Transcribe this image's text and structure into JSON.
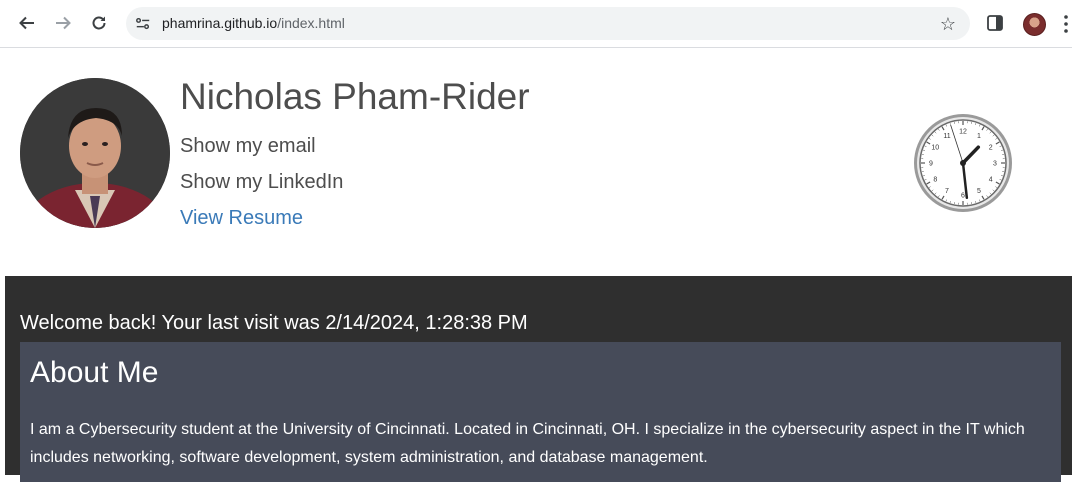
{
  "browser": {
    "url_host": "phamrina.github.io",
    "url_path": "/index.html"
  },
  "header": {
    "name": "Nicholas Pham-Rider",
    "email_link": "Show my email",
    "linkedin_link": "Show my LinkedIn",
    "resume_link": "View Resume"
  },
  "clock": {
    "numerals": [
      "12",
      "1",
      "2",
      "3",
      "4",
      "5",
      "6",
      "7",
      "8",
      "9",
      "10",
      "11"
    ],
    "time_shown": "1:28:57"
  },
  "welcome": {
    "message": "Welcome back! Your last visit was 2/14/2024, 1:28:38 PM"
  },
  "about": {
    "heading": "About Me",
    "text": "I am a Cybersecurity student at the University of Cincinnati. Located in Cincinnati, OH. I specialize in the cybersecurity aspect in the IT which includes networking, software development, system administration, and database management."
  },
  "colors": {
    "dark_background": "#2f2f2f",
    "about_background": "#464b59",
    "link_blue": "#3a7ab8",
    "name_gray": "#4d4d4d"
  }
}
